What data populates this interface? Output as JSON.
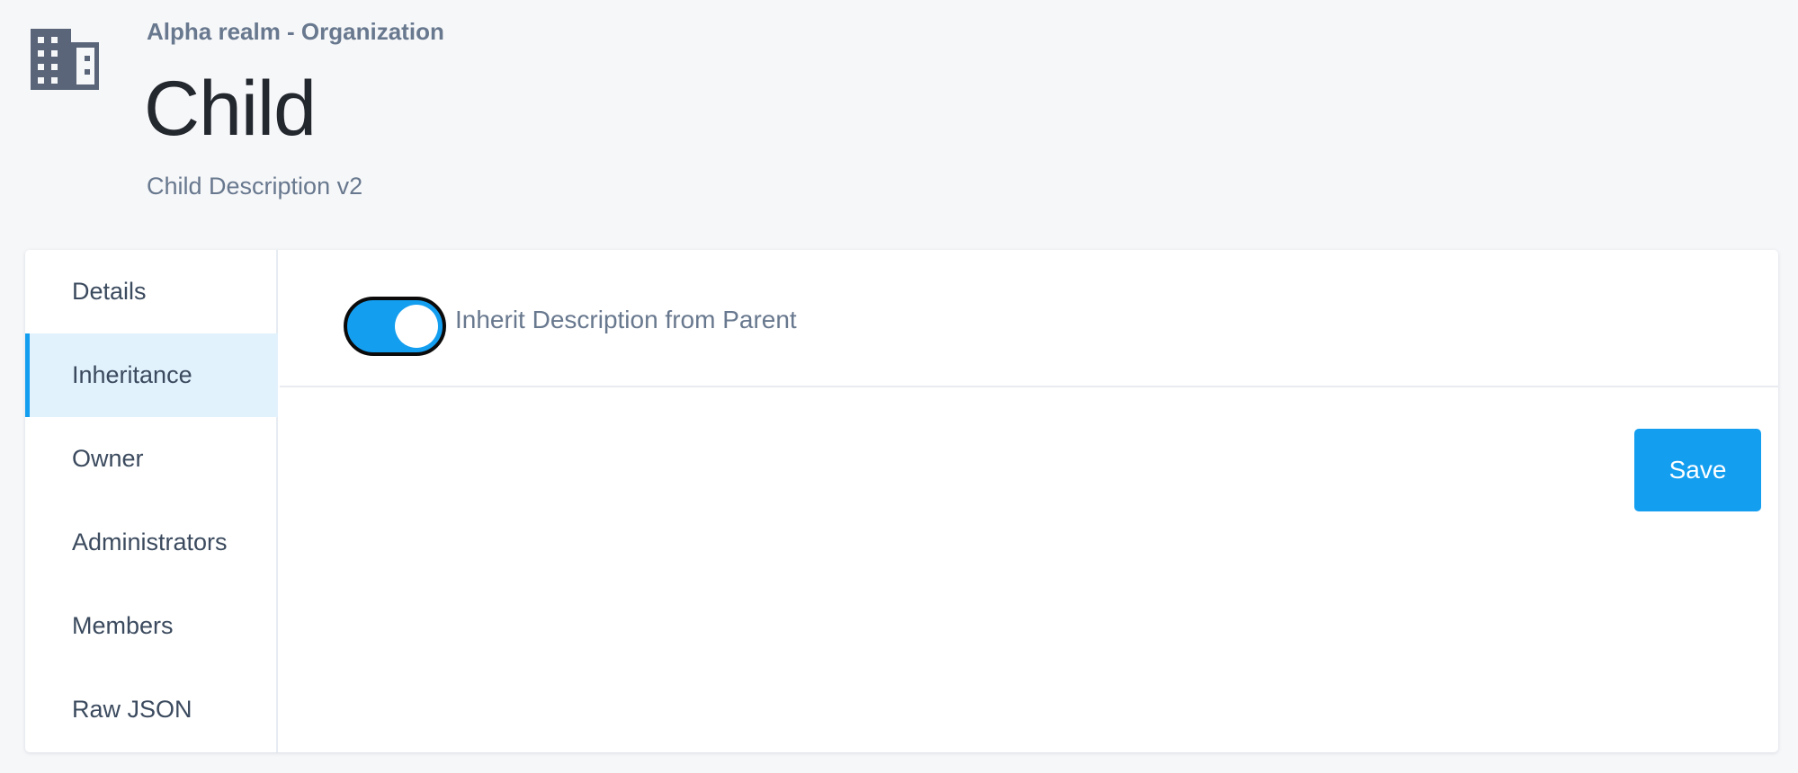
{
  "header": {
    "icon": "building-icon",
    "realm_label": "Alpha realm - Organization",
    "title": "Child",
    "description": "Child Description v2"
  },
  "sidebar": {
    "active_index": 1,
    "items": [
      {
        "label": "Details"
      },
      {
        "label": "Inheritance"
      },
      {
        "label": "Owner"
      },
      {
        "label": "Administrators"
      },
      {
        "label": "Members"
      },
      {
        "label": "Raw JSON"
      }
    ]
  },
  "inheritance": {
    "toggle_label": "Inherit Description from Parent",
    "toggle_on": true,
    "save_label": "Save"
  },
  "colors": {
    "accent": "#149ef0",
    "active_bg": "#e2f2fc",
    "text_muted": "#68788e",
    "text_dark": "#23272e",
    "background": "#f6f7f9"
  }
}
